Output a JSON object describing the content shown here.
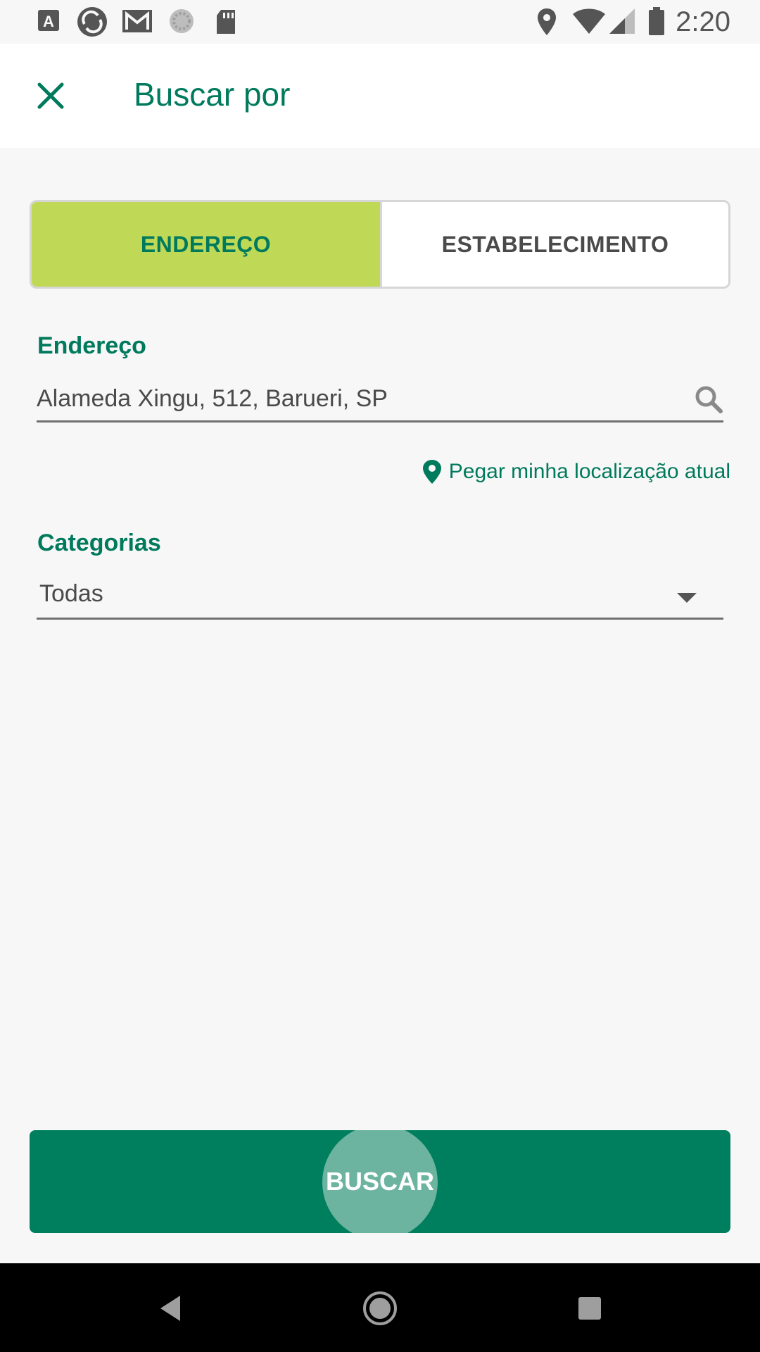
{
  "status_bar": {
    "time": "2:20",
    "left_icons": [
      "a-icon",
      "sync-icon",
      "gmail-icon",
      "loading-icon",
      "sd-card-icon"
    ],
    "right_icons": [
      "location-icon",
      "wifi-icon",
      "signal-icon",
      "battery-icon"
    ]
  },
  "app_bar": {
    "title": "Buscar por",
    "close_icon": "close-icon"
  },
  "segmented": {
    "tabs": [
      {
        "label": "ENDEREÇO",
        "active": true
      },
      {
        "label": "ESTABELECIMENTO",
        "active": false
      }
    ]
  },
  "address": {
    "label": "Endereço",
    "value": "Alameda Xingu, 512, Barueri, SP",
    "icon": "search-icon"
  },
  "location_link": {
    "label": "Pegar minha localização atual",
    "icon": "map-pin-icon"
  },
  "categories": {
    "label": "Categorias",
    "selected": "Todas",
    "icon": "chevron-down-icon"
  },
  "buscar_button": {
    "label": "BUSCAR"
  },
  "nav_bar": {
    "buttons": [
      "back-icon",
      "home-icon",
      "recents-icon"
    ]
  },
  "colors": {
    "primary": "#007a5c",
    "accent_lime": "#bfd957",
    "button_green": "#007f5f",
    "background": "#f7f7f7"
  }
}
